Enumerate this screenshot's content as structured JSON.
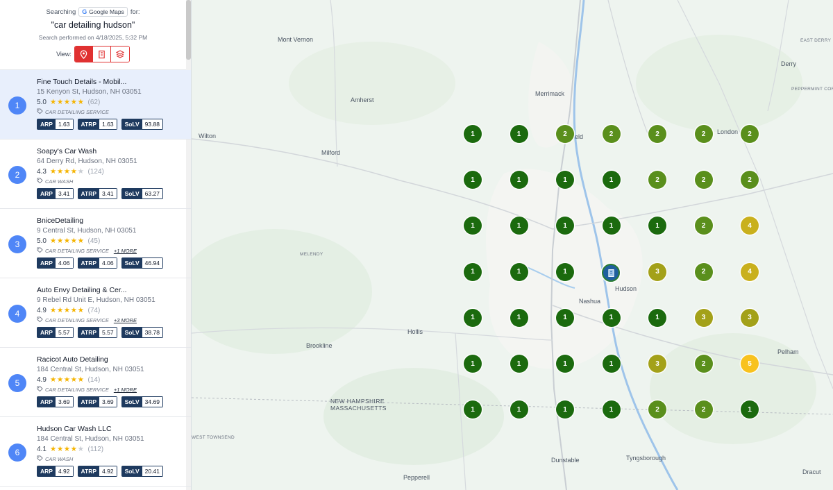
{
  "header": {
    "searching_label": "Searching",
    "source_label": "Google Maps",
    "for_label": "for:",
    "query": "\"car detailing hudson\"",
    "performed": "Search performed on 4/18/2025, 5:32 PM",
    "view_label": "View:",
    "view_options": [
      "pin-icon",
      "building-icon",
      "layers-icon"
    ],
    "active_view": "pin-icon"
  },
  "results": [
    {
      "rank": "1",
      "name": "Fine Touch Details - Mobil...",
      "address": "15 Kenyon St, Hudson, NH 03051",
      "rating": "5.0",
      "stars": 5,
      "reviews": "(62)",
      "category": "CAR DETAILING SERVICE",
      "more": "",
      "arp": "1.63",
      "atrp": "1.63",
      "solv": "93.88",
      "selected": true
    },
    {
      "rank": "2",
      "name": "Soapy's Car Wash",
      "address": "64 Derry Rd, Hudson, NH 03051",
      "rating": "4.3",
      "stars": 4,
      "reviews": "(124)",
      "category": "CAR WASH",
      "more": "",
      "arp": "3.41",
      "atrp": "3.41",
      "solv": "63.27",
      "selected": false
    },
    {
      "rank": "3",
      "name": "BniceDetailing",
      "address": "9 Central St, Hudson, NH 03051",
      "rating": "5.0",
      "stars": 5,
      "reviews": "(45)",
      "category": "CAR DETAILING SERVICE",
      "more": "+1 MORE",
      "arp": "4.06",
      "atrp": "4.06",
      "solv": "46.94",
      "selected": false
    },
    {
      "rank": "4",
      "name": "Auto Envy Detailing & Cer...",
      "address": "9 Rebel Rd Unit E, Hudson, NH 03051",
      "rating": "4.9",
      "stars": 5,
      "reviews": "(74)",
      "category": "CAR DETAILING SERVICE",
      "more": "+3 MORE",
      "arp": "5.57",
      "atrp": "5.57",
      "solv": "38.78",
      "selected": false
    },
    {
      "rank": "5",
      "name": "Racicot Auto Detailing",
      "address": "184 Central St, Hudson, NH 03051",
      "rating": "4.9",
      "stars": 5,
      "reviews": "(14)",
      "category": "CAR DETAILING SERVICE",
      "more": "+1 MORE",
      "arp": "3.69",
      "atrp": "3.69",
      "solv": "34.69",
      "selected": false
    },
    {
      "rank": "6",
      "name": "Hudson Car Wash LLC",
      "address": "184 Central St, Hudson, NH 03051",
      "rating": "4.1",
      "stars": 4,
      "reviews": "(112)",
      "category": "CAR WASH",
      "more": "",
      "arp": "4.92",
      "atrp": "4.92",
      "solv": "20.41",
      "selected": false
    }
  ],
  "metric_labels": {
    "arp": "ARP",
    "atrp": "ATRP",
    "solv": "SoLV"
  },
  "map": {
    "towns": [
      {
        "name": "Mont Vernon",
        "kind": "town"
      },
      {
        "name": "Amherst",
        "kind": "town"
      },
      {
        "name": "Merrimack",
        "kind": "town"
      },
      {
        "name": "Wilton",
        "kind": "town"
      },
      {
        "name": "Milford",
        "kind": "town"
      },
      {
        "name": "Londonderry",
        "kind": "town",
        "visible_text": "London"
      },
      {
        "name": "Derry",
        "kind": "town"
      },
      {
        "name": "EAST DERRY",
        "kind": "small"
      },
      {
        "name": "PEPPERMINT CORNER",
        "kind": "small"
      },
      {
        "name": "MELENDY",
        "kind": "small"
      },
      {
        "name": "Hudson",
        "kind": "town"
      },
      {
        "name": "Nashua",
        "kind": "town"
      },
      {
        "name": "Hollis",
        "kind": "town"
      },
      {
        "name": "Brookline",
        "kind": "town"
      },
      {
        "name": "Pelham",
        "kind": "town"
      },
      {
        "name": "NEW HAMPSHIRE",
        "kind": "state"
      },
      {
        "name": "MASSACHUSETTS",
        "kind": "state"
      },
      {
        "name": "WEST TOWNSEND",
        "kind": "small"
      },
      {
        "name": "Dunstable",
        "kind": "town"
      },
      {
        "name": "Tyngsborough",
        "kind": "town"
      },
      {
        "name": "Pepperell",
        "kind": "town"
      },
      {
        "name": "Dracut",
        "kind": "town"
      },
      {
        "name": "Field",
        "kind": "town",
        "visible_text": "eld"
      }
    ],
    "rank_grid": [
      [
        1,
        1,
        2,
        2,
        2,
        2,
        2
      ],
      [
        1,
        1,
        1,
        1,
        2,
        2,
        2
      ],
      [
        1,
        1,
        1,
        1,
        1,
        2,
        4
      ],
      [
        1,
        1,
        1,
        0,
        3,
        2,
        4
      ],
      [
        1,
        1,
        1,
        1,
        1,
        3,
        3
      ],
      [
        1,
        1,
        1,
        1,
        3,
        2,
        5
      ],
      [
        1,
        1,
        1,
        1,
        2,
        2,
        1
      ]
    ],
    "center_marker": "business-pin-icon",
    "rank_colors": {
      "1": "#1b6a0e",
      "2": "#5a8f1c",
      "3": "#a3a119",
      "4": "#c9b01d",
      "5": "#f8c21e"
    }
  }
}
